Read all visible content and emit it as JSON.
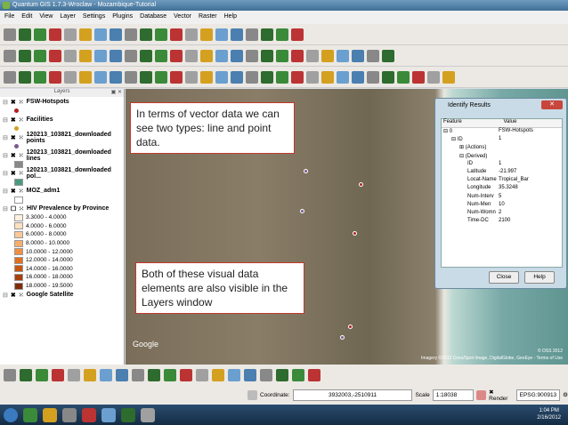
{
  "window": {
    "title": "Quantum GIS 1.7.3-Wroclaw - Mozambique-Tutorial"
  },
  "menu": [
    "File",
    "Edit",
    "View",
    "Layer",
    "Settings",
    "Plugins",
    "Database",
    "Vector",
    "Raster",
    "Help"
  ],
  "layers_panel": {
    "title": "Layers",
    "controls": "▣ ✕",
    "layers": [
      {
        "name": "FSW-Hotspots",
        "symbol_color": "#b02020"
      },
      {
        "name": "Facilities",
        "symbol_color": "#d4a020"
      },
      {
        "name": "120213_103821_downloaded points",
        "symbol_color": "#7a5a8a"
      },
      {
        "name": "120213_103821_downloaded lines",
        "symbol_color": "#888888"
      },
      {
        "name": "120213_103821_downloaded pol...",
        "symbol_color": "#4a9a80"
      },
      {
        "name": "MOZ_adm1",
        "symbol_color": "#ffffff"
      },
      {
        "name": "HIV Prevalence by Province",
        "legend": [
          {
            "label": "3.3000 - 4.0000",
            "color": "#fdf0e0"
          },
          {
            "label": "4.0000 - 6.0000",
            "color": "#fde0c0"
          },
          {
            "label": "6.0000 - 8.0000",
            "color": "#fcc898"
          },
          {
            "label": "8.0000 - 10.0000",
            "color": "#f9ad6c"
          },
          {
            "label": "10.0000 - 12.0000",
            "color": "#f18f40"
          },
          {
            "label": "12.0000 - 14.0000",
            "color": "#e0701e"
          },
          {
            "label": "14.0000 - 16.0000",
            "color": "#c85610"
          },
          {
            "label": "16.0000 - 18.0000",
            "color": "#a8400a"
          },
          {
            "label": "18.0000 - 19.5000",
            "color": "#802c06"
          }
        ]
      },
      {
        "name": "Google Satellite"
      }
    ]
  },
  "callouts": {
    "top": "In terms of vector data we can see two types: line and point data.",
    "bottom": "Both of these visual data elements are also visible in the Layers window"
  },
  "map": {
    "attribution": "Imagery ©2012 Cnes/Spot Image, DigitalGlobe, GeoEye - Terms of Use",
    "copyright": "© OSS 2012",
    "google": "Google"
  },
  "identify": {
    "title": "Identify Results",
    "col_feature": "Feature",
    "col_value": "Value",
    "rows": [
      {
        "k": "⊟ 0",
        "v": "FSW-Hotspots",
        "i": 0
      },
      {
        "k": "⊟ ID",
        "v": "1",
        "i": 1
      },
      {
        "k": "⊞ (Actions)",
        "v": "",
        "i": 2
      },
      {
        "k": "⊟ (Derived)",
        "v": "",
        "i": 2
      },
      {
        "k": "ID",
        "v": "1",
        "i": 3
      },
      {
        "k": "Latitude",
        "v": "-21.997",
        "i": 3
      },
      {
        "k": "Locat-Name",
        "v": "Tropical_Bar",
        "i": 3
      },
      {
        "k": "Longitude",
        "v": "35.3248",
        "i": 3
      },
      {
        "k": "Num-Interv",
        "v": "5",
        "i": 3
      },
      {
        "k": "Num-Men",
        "v": "10",
        "i": 3
      },
      {
        "k": "Num-Womn",
        "v": "2",
        "i": 3
      },
      {
        "k": "Time-DC",
        "v": "2100",
        "i": 3
      }
    ],
    "close": "Close",
    "help": "Help"
  },
  "status": {
    "coord_label": "Coordinate:",
    "coord": "3932003,-2510911",
    "scale_label": "Scale",
    "scale": "1:18038",
    "render": "Render",
    "epsg": "EPSG:900913"
  },
  "clock": {
    "time": "1:04 PM",
    "date": "2/16/2012"
  }
}
